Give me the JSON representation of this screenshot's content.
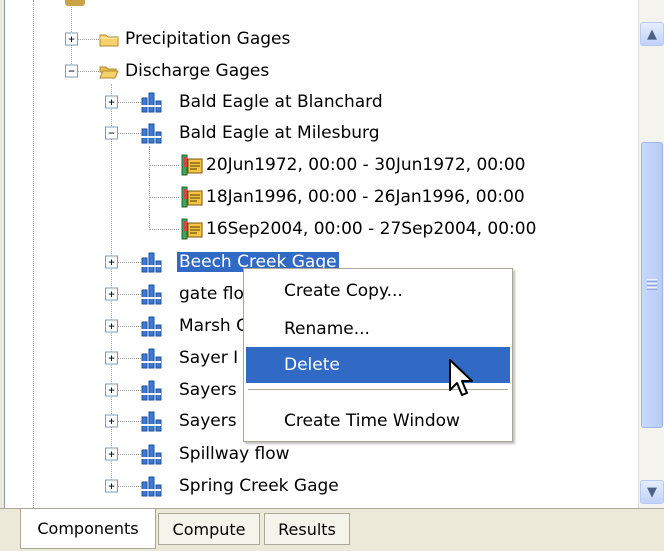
{
  "tree": {
    "precip_label": "Precipitation Gages",
    "discharge_label": "Discharge Gages",
    "gages": [
      {
        "label": "Bald Eagle at Blanchard",
        "expanded": false
      },
      {
        "label": "Bald Eagle at Milesburg",
        "expanded": true
      },
      {
        "label": "Beech Creek Gage",
        "expanded": false,
        "selected": true
      },
      {
        "label": "gate flo",
        "expanded": false
      },
      {
        "label": "Marsh C",
        "expanded": false
      },
      {
        "label": "Sayer I",
        "expanded": false
      },
      {
        "label": "Sayers",
        "expanded": false
      },
      {
        "label": "Sayers",
        "expanded": false
      },
      {
        "label": "Spillway flow",
        "expanded": false
      },
      {
        "label": "Spring Creek Gage",
        "expanded": false
      }
    ],
    "time_windows": [
      "20Jun1972, 00:00 - 30Jun1972, 00:00",
      "18Jan1996, 00:00 - 26Jan1996, 00:00",
      "16Sep2004, 00:00 - 27Sep2004, 00:00"
    ],
    "expand_glyph": "+",
    "collapse_glyph": "−"
  },
  "context_menu": {
    "items": [
      "Create Copy...",
      "Rename...",
      "Delete",
      "Create Time Window"
    ],
    "highlighted": "Delete"
  },
  "tabs": [
    "Components",
    "Compute",
    "Results"
  ],
  "active_tab": "Components",
  "colors": {
    "selection": "#316ac5",
    "folder": "#f6d36a",
    "gage": "#3a7bd5"
  }
}
